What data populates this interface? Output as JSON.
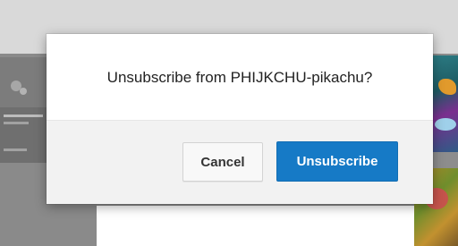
{
  "dialog": {
    "title": "Unsubscribe from PHIJKCHU-pikachu?",
    "cancel_label": "Cancel",
    "confirm_label": "Unsubscribe"
  },
  "colors": {
    "confirm_button": "#167ac6",
    "overlay": "#8f8f8f"
  }
}
